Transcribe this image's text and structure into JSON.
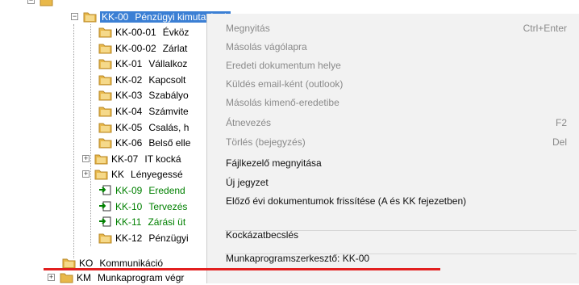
{
  "tree": {
    "top_partial": "",
    "root": {
      "code": "KK-00",
      "label": "Pénzügyi kimutatások"
    },
    "children": [
      {
        "code": "KK-00-01",
        "label": "Évköz",
        "color": "black",
        "icon": "folder"
      },
      {
        "code": "KK-00-02",
        "label": "Zárlat",
        "color": "black",
        "icon": "folder"
      },
      {
        "code": "KK-01",
        "label": "Vállalkoz",
        "color": "black",
        "icon": "folder"
      },
      {
        "code": "KK-02",
        "label": "Kapcsolt",
        "color": "black",
        "icon": "folder"
      },
      {
        "code": "KK-03",
        "label": "Szabályo",
        "color": "black",
        "icon": "folder"
      },
      {
        "code": "KK-04",
        "label": "Számvite",
        "color": "black",
        "icon": "folder"
      },
      {
        "code": "KK-05",
        "label": "Csalás, h",
        "color": "black",
        "icon": "folder"
      },
      {
        "code": "KK-06",
        "label": "Belső elle",
        "color": "black",
        "icon": "folder"
      },
      {
        "code": "KK-07",
        "label": "IT kocká",
        "color": "black",
        "icon": "folder",
        "expandable": true
      },
      {
        "code": "KK",
        "label": "Lényegessé",
        "color": "black",
        "icon": "folder",
        "expandable": true
      },
      {
        "code": "KK-09",
        "label": "Eredend",
        "color": "green",
        "icon": "doc"
      },
      {
        "code": "KK-10",
        "label": "Tervezés",
        "color": "green",
        "icon": "doc"
      },
      {
        "code": "KK-11",
        "label": "Zárási üt",
        "color": "green",
        "icon": "doc"
      },
      {
        "code": "KK-12",
        "label": "Pénzügyi",
        "color": "black",
        "icon": "folder"
      }
    ],
    "ko": {
      "code": "KO",
      "label": "Kommunikáció"
    },
    "km": {
      "code": "KM",
      "label": "Munkaprogram végr"
    }
  },
  "menu": {
    "items": [
      {
        "label": "Megnyitás",
        "shortcut": "Ctrl+Enter",
        "enabled": false
      },
      {
        "label": "Másolás vágólapra",
        "shortcut": "",
        "enabled": false
      },
      {
        "label": "Eredeti dokumentum helye",
        "shortcut": "",
        "enabled": false
      },
      {
        "label": "Küldés email-ként (outlook)",
        "shortcut": "",
        "enabled": false
      },
      {
        "label": "Másolás kimenő-eredetibe",
        "shortcut": "",
        "enabled": false
      },
      {
        "label": "Átnevezés",
        "shortcut": "F2",
        "enabled": false
      },
      {
        "label": "Törlés (bejegyzés)",
        "shortcut": "Del",
        "enabled": false
      },
      {
        "label": "Fájlkezelő megnyitása",
        "shortcut": "",
        "enabled": true
      },
      {
        "label": "Új jegyzet",
        "shortcut": "",
        "enabled": true
      },
      {
        "label": "Előző évi dokumentumok frissítése (A és KK fejezetben)",
        "shortcut": "",
        "enabled": true
      },
      {
        "label": "Kockázatbecslés",
        "shortcut": "",
        "enabled": true
      },
      {
        "label": "Munkaprogramszerkesztő: KK-00",
        "shortcut": "",
        "enabled": true
      }
    ]
  },
  "colors": {
    "selection": "#3b7fd4",
    "green_text": "#008000",
    "menu_bg": "#f2f2f2",
    "annotation_line": "#e21f1f",
    "folder": "#e8b84a"
  }
}
